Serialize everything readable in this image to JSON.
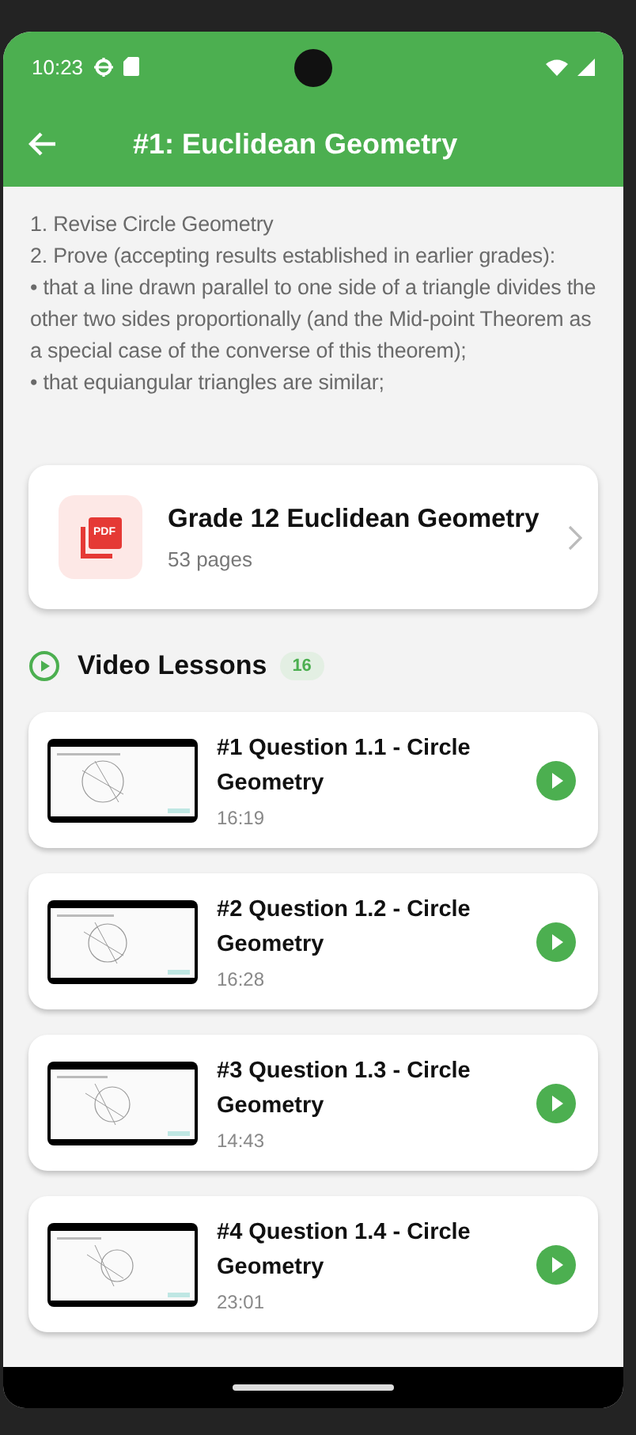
{
  "status_bar": {
    "time": "10:23"
  },
  "app_bar": {
    "title": "#1: Euclidean Geometry"
  },
  "description": [
    "1. Revise Circle Geometry",
    "2. Prove (accepting results established in earlier grades):",
    "• that a line drawn parallel to one side of a triangle divides the other two sides proportionally (and the Mid-point Theorem as a special case of the converse of this theorem);",
    "• that equiangular triangles are similar;"
  ],
  "document": {
    "icon_label": "PDF",
    "title": "Grade 12 Euclidean Geometry",
    "pages": "53 pages"
  },
  "videos_section": {
    "title": "Video Lessons",
    "count": "16"
  },
  "videos": [
    {
      "title": "#1 Question 1.1 - Circle Geometry",
      "duration": "16:19"
    },
    {
      "title": "#2 Question 1.2 - Circle Geometry",
      "duration": "16:28"
    },
    {
      "title": "#3 Question 1.3 - Circle Geometry",
      "duration": "14:43"
    },
    {
      "title": "#4 Question 1.4 - Circle Geometry",
      "duration": "23:01"
    }
  ]
}
